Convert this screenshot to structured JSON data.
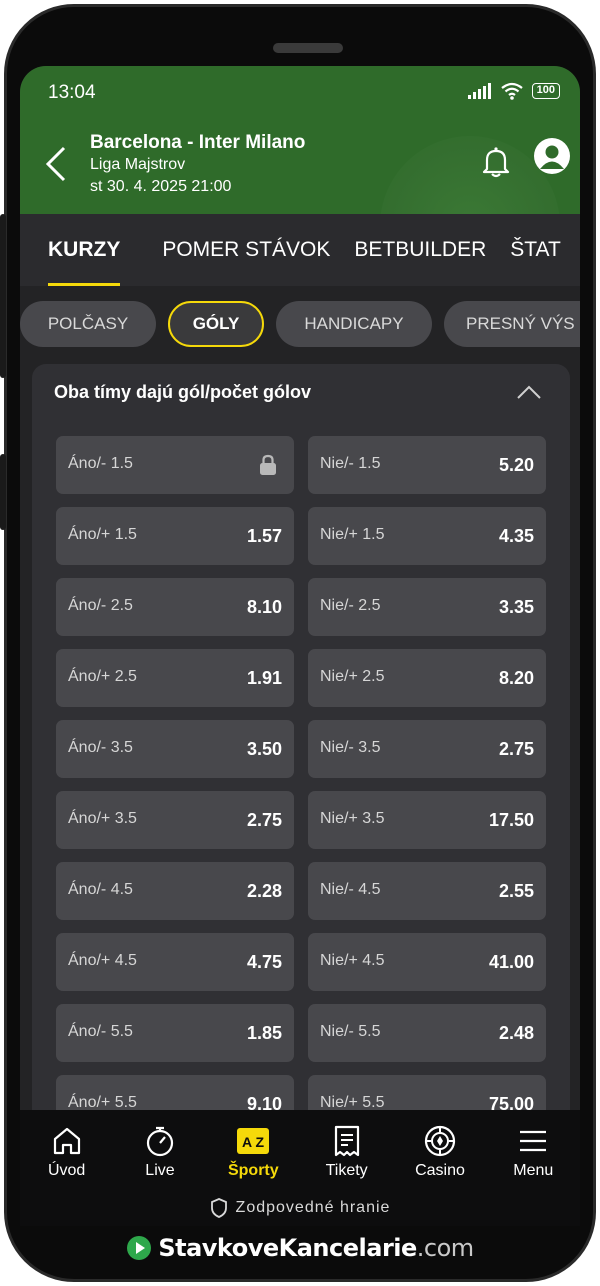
{
  "status": {
    "time": "13:04",
    "battery": "100"
  },
  "match": {
    "title": "Barcelona - Inter Milano",
    "league": "Liga Majstrov",
    "date": "st 30. 4. 2025 21:00"
  },
  "tabs": [
    "KURZY",
    "POMER STÁVOK",
    "BETBUILDER",
    "ŠTAT"
  ],
  "chips": [
    "POLČASY",
    "GÓLY",
    "HANDICAPY",
    "PRESNÝ VÝS"
  ],
  "market": {
    "title": "Oba tímy dajú gól/počet gólov",
    "rows": [
      {
        "left_label": "Áno/- 1.5",
        "left_value": "",
        "left_locked": true,
        "right_label": "Nie/- 1.5",
        "right_value": "5.20"
      },
      {
        "left_label": "Áno/+ 1.5",
        "left_value": "1.57",
        "right_label": "Nie/+ 1.5",
        "right_value": "4.35"
      },
      {
        "left_label": "Áno/- 2.5",
        "left_value": "8.10",
        "right_label": "Nie/- 2.5",
        "right_value": "3.35"
      },
      {
        "left_label": "Áno/+ 2.5",
        "left_value": "1.91",
        "right_label": "Nie/+ 2.5",
        "right_value": "8.20"
      },
      {
        "left_label": "Áno/- 3.5",
        "left_value": "3.50",
        "right_label": "Nie/- 3.5",
        "right_value": "2.75"
      },
      {
        "left_label": "Áno/+ 3.5",
        "left_value": "2.75",
        "right_label": "Nie/+ 3.5",
        "right_value": "17.50"
      },
      {
        "left_label": "Áno/- 4.5",
        "left_value": "2.28",
        "right_label": "Nie/- 4.5",
        "right_value": "2.55"
      },
      {
        "left_label": "Áno/+ 4.5",
        "left_value": "4.75",
        "right_label": "Nie/+ 4.5",
        "right_value": "41.00"
      },
      {
        "left_label": "Áno/- 5.5",
        "left_value": "1.85",
        "right_label": "Nie/- 5.5",
        "right_value": "2.48"
      },
      {
        "left_label": "Áno/+ 5.5",
        "left_value": "9.10",
        "right_label": "Nie/+ 5.5",
        "right_value": "75.00"
      }
    ]
  },
  "nav": [
    "Úvod",
    "Live",
    "Športy",
    "Tikety",
    "Casino",
    "Menu"
  ],
  "nav_active": "Športy",
  "responsible": "Zodpovedné hranie",
  "brand": {
    "name": "StavkoveKancelarie",
    "suffix": ".com"
  },
  "colors": {
    "accent": "#f5d90a",
    "header": "#2f6b2a",
    "brand_green": "#2ea84b"
  }
}
